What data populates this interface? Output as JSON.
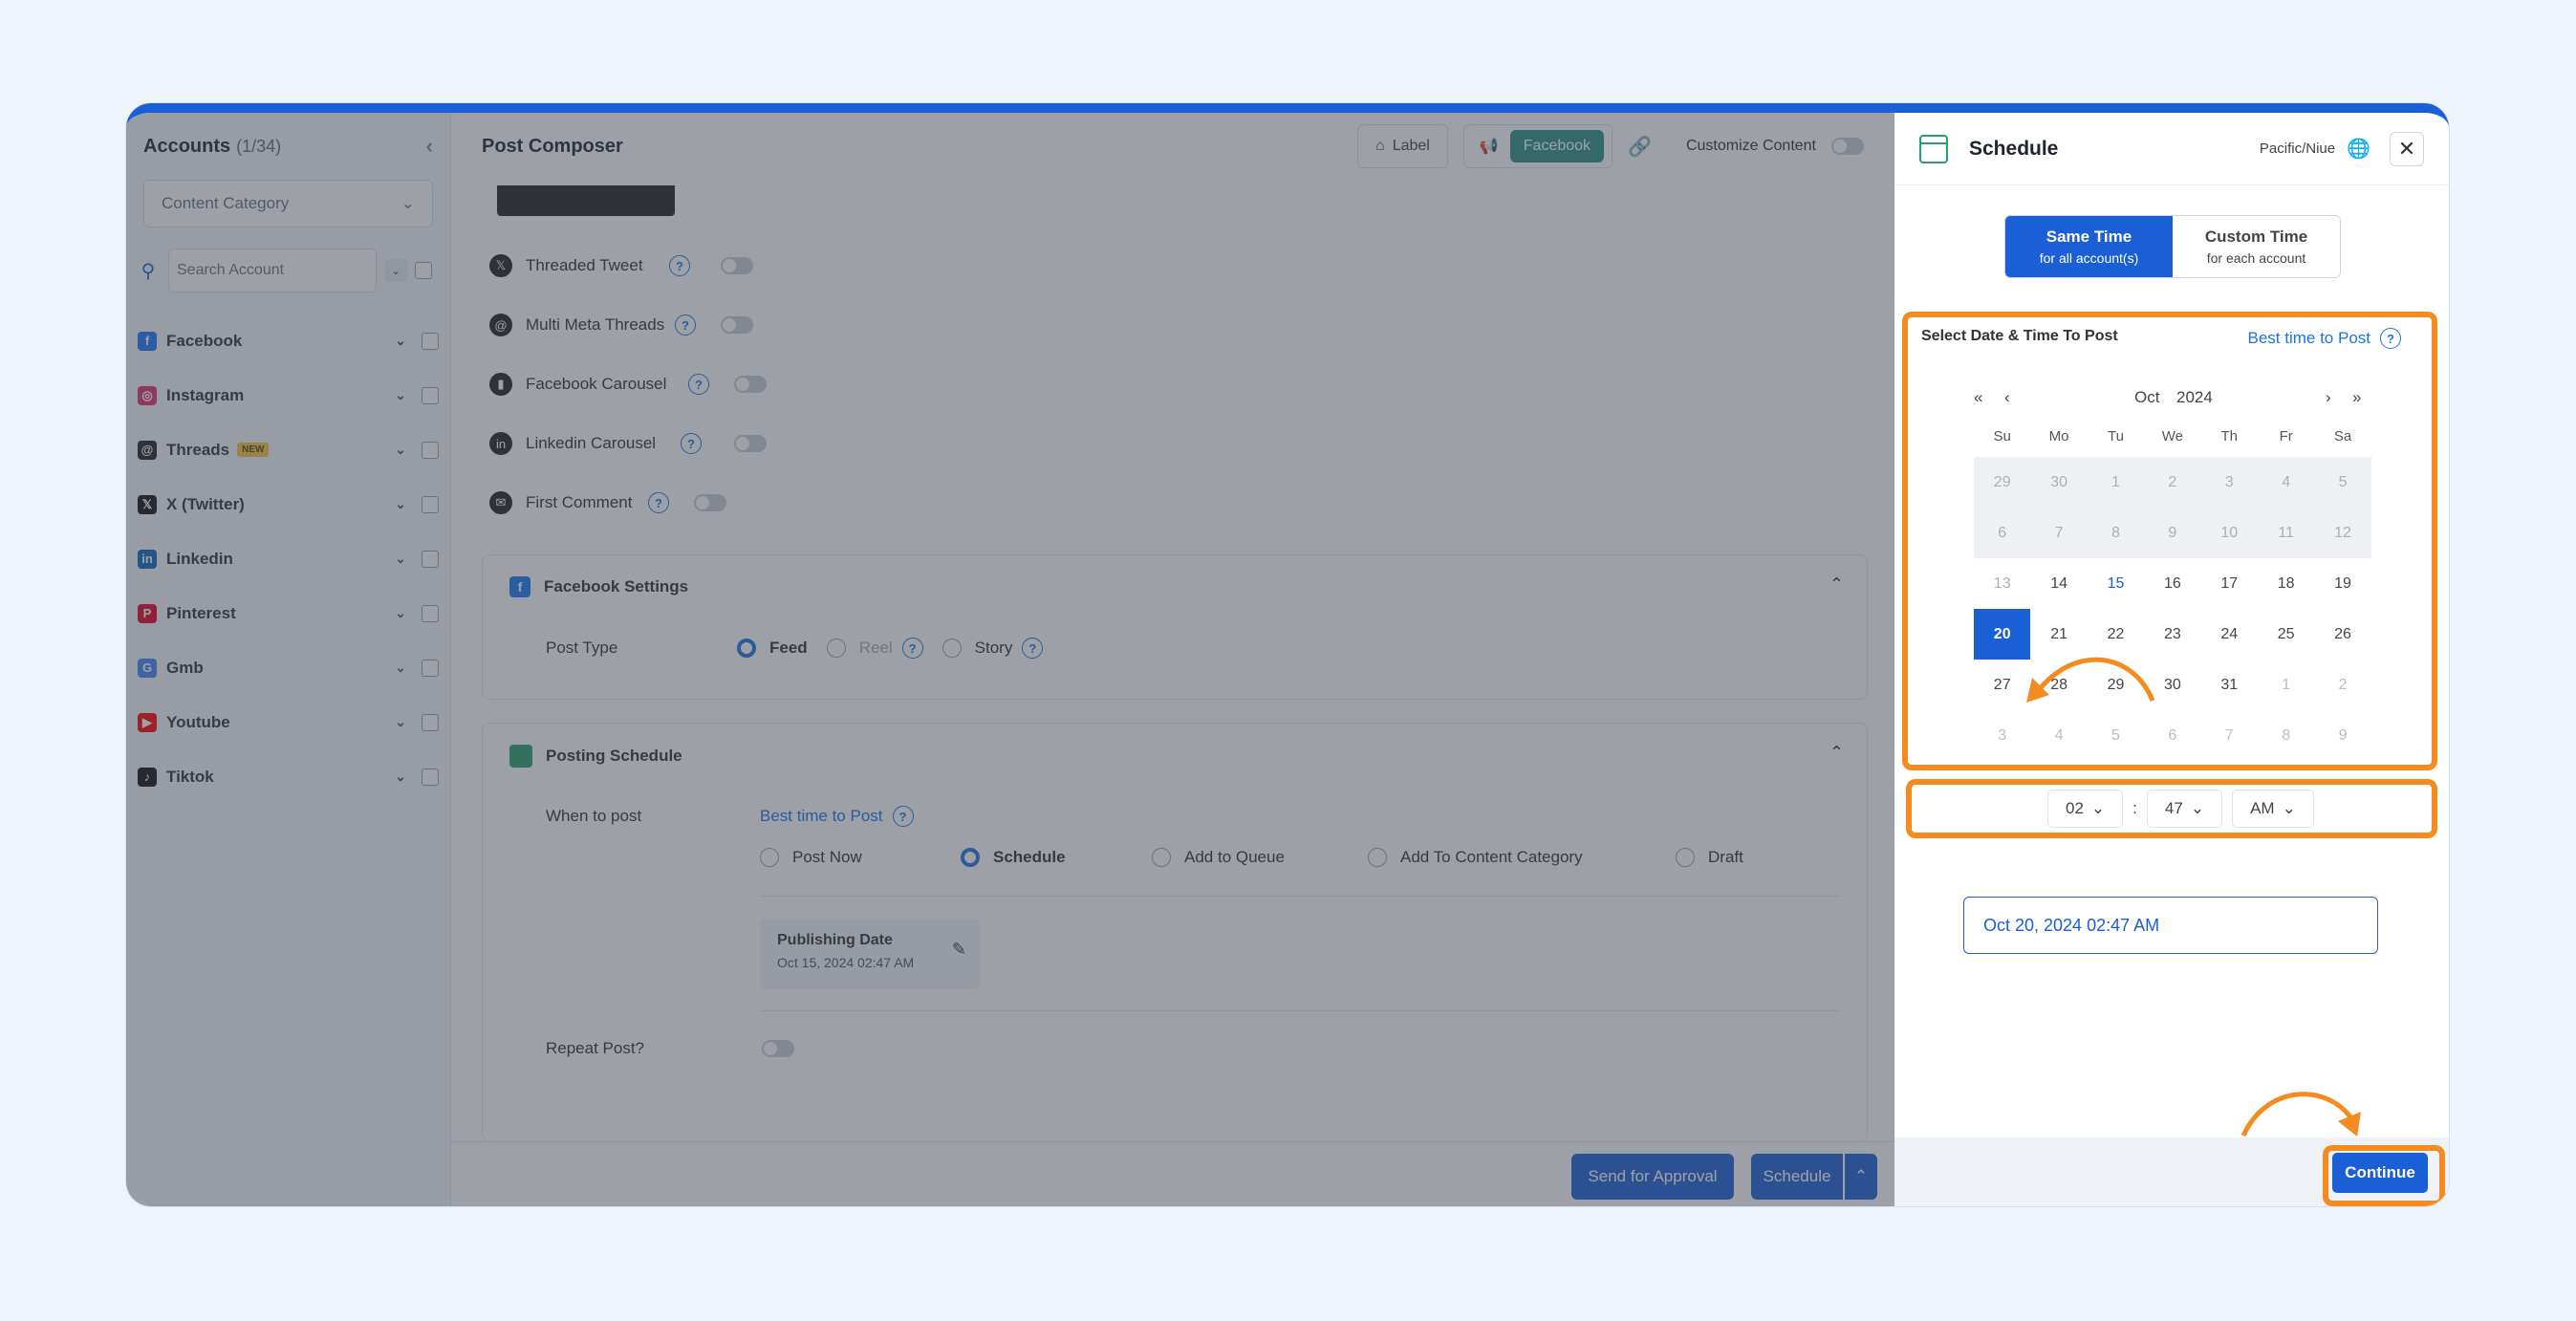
{
  "accounts": {
    "title": "Accounts",
    "count": "(1/34)",
    "category_placeholder": "Content Category",
    "search_placeholder": "Search Account",
    "items": [
      {
        "label": "Facebook",
        "color": "#1877f2",
        "glyph": "f"
      },
      {
        "label": "Instagram",
        "color": "#e1306c",
        "glyph": "◎"
      },
      {
        "label": "Threads",
        "color": "#222222",
        "glyph": "@",
        "badge": "NEW"
      },
      {
        "label": "X (Twitter)",
        "color": "#111111",
        "glyph": "𝕏"
      },
      {
        "label": "Linkedin",
        "color": "#0a66c2",
        "glyph": "in"
      },
      {
        "label": "Pinterest",
        "color": "#e60023",
        "glyph": "P"
      },
      {
        "label": "Gmb",
        "color": "#4285f4",
        "glyph": "G"
      },
      {
        "label": "Youtube",
        "color": "#ff0000",
        "glyph": "▶"
      },
      {
        "label": "Tiktok",
        "color": "#111111",
        "glyph": "♪"
      }
    ]
  },
  "composer": {
    "title": "Post Composer",
    "label_button": "Label",
    "facebook_tab": "Facebook",
    "customize_label": "Customize Content",
    "options": [
      {
        "label": "Threaded Tweet",
        "glyph": "𝕏"
      },
      {
        "label": "Multi Meta Threads",
        "glyph": "@"
      },
      {
        "label": "Facebook Carousel",
        "glyph": "▮"
      },
      {
        "label": "Linkedin Carousel",
        "glyph": "in"
      },
      {
        "label": "First Comment",
        "glyph": "✉"
      }
    ],
    "fb_settings": {
      "title": "Facebook Settings",
      "post_type_label": "Post Type",
      "types": [
        "Feed",
        "Reel",
        "Story"
      ]
    },
    "posting_schedule": {
      "title": "Posting Schedule",
      "when_label": "When to post",
      "best_time": "Best time to Post",
      "modes": [
        "Post Now",
        "Schedule",
        "Add to Queue",
        "Add To Content Category",
        "Draft"
      ],
      "publishing_title": "Publishing Date",
      "publishing_value": "Oct 15, 2024 02:47 AM",
      "repeat_label": "Repeat Post?"
    },
    "send_approval": "Send for Approval",
    "schedule_button": "Schedule"
  },
  "schedule_panel": {
    "title": "Schedule",
    "timezone": "Pacific/Niue",
    "same_time": {
      "title": "Same Time",
      "sub": "for all account(s)"
    },
    "custom_time": {
      "title": "Custom Time",
      "sub": "for each account"
    },
    "picker_title": "Select Date & Time To Post",
    "best_time": "Best time to Post",
    "month": "Oct",
    "year": "2024",
    "day_headers": [
      "Su",
      "Mo",
      "Tu",
      "We",
      "Th",
      "Fr",
      "Sa"
    ],
    "weeks": [
      [
        "29",
        "30",
        "1",
        "2",
        "3",
        "4",
        "5"
      ],
      [
        "6",
        "7",
        "8",
        "9",
        "10",
        "11",
        "12"
      ],
      [
        "13",
        "14",
        "15",
        "16",
        "17",
        "18",
        "19"
      ],
      [
        "20",
        "21",
        "22",
        "23",
        "24",
        "25",
        "26"
      ],
      [
        "27",
        "28",
        "29",
        "30",
        "31",
        "1",
        "2"
      ],
      [
        "3",
        "4",
        "5",
        "6",
        "7",
        "8",
        "9"
      ]
    ],
    "selected_day": "20",
    "hour": "02",
    "minute": "47",
    "ampm": "AM",
    "summary": "Oct 20, 2024 02:47 AM",
    "continue": "Continue"
  },
  "colors": {
    "accent": "#1a5fd6",
    "highlight": "#f48b20"
  }
}
